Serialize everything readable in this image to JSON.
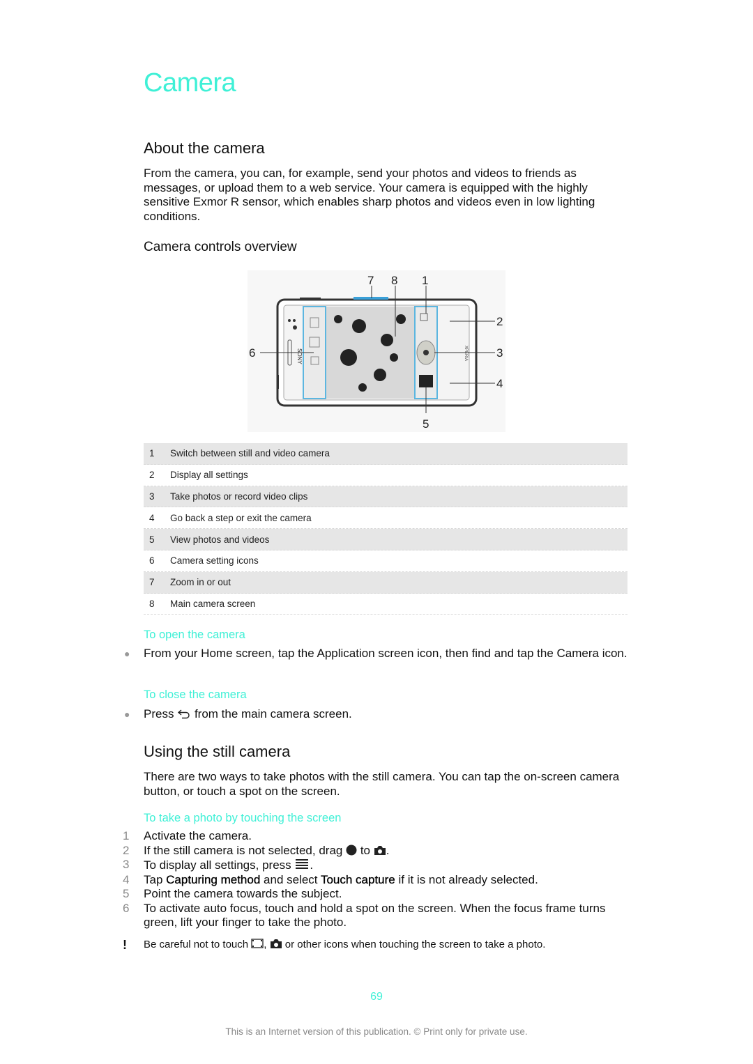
{
  "chapter_title": "Camera",
  "about": {
    "heading": "About the camera",
    "body": "From the camera, you can, for example, send your photos and videos to friends as messages, or upload them to a web service. Your camera is equipped with the highly sensitive Exmor R sensor, which enables sharp photos and videos even in low lighting conditions."
  },
  "controls": {
    "heading": "Camera controls overview",
    "figure": {
      "callouts": [
        "1",
        "2",
        "3",
        "4",
        "5",
        "6",
        "7",
        "8"
      ],
      "brand_left": "SONY",
      "brand_right": "XPERIA"
    },
    "legend": [
      {
        "num": "1",
        "label": "Switch between still and video camera"
      },
      {
        "num": "2",
        "label": "Display all settings"
      },
      {
        "num": "3",
        "label": "Take photos or record video clips"
      },
      {
        "num": "4",
        "label": "Go back a step or exit the camera"
      },
      {
        "num": "5",
        "label": "View photos and videos"
      },
      {
        "num": "6",
        "label": "Camera setting icons"
      },
      {
        "num": "7",
        "label": "Zoom in or out"
      },
      {
        "num": "8",
        "label": "Main camera screen"
      }
    ]
  },
  "open_camera": {
    "heading": "To open the camera",
    "bullet": "From your Home screen, tap the Application screen icon, then find and tap the Camera icon."
  },
  "close_camera": {
    "heading": "To close the camera",
    "bullet_pre": "Press",
    "bullet_post": "from the main camera screen.",
    "icon": "back-icon"
  },
  "still_camera": {
    "heading": "Using the still camera",
    "body": "There are two ways to take photos with the still camera. You can tap the on-screen camera button, or touch a spot on the screen.",
    "procedure_heading": "To take a photo by touching the screen",
    "steps": [
      {
        "num": "1",
        "text": "Activate the camera."
      },
      {
        "num": "2",
        "pre": "If the still camera is not selected, drag",
        "mid": "to",
        "post": "."
      },
      {
        "num": "3",
        "pre": "To display all settings, press",
        "post": "."
      },
      {
        "num": "4",
        "pre": "Tap",
        "bold1": "Capturing method",
        "mid": "and select",
        "bold2": "Touch capture",
        "post": "if it is not already selected."
      },
      {
        "num": "5",
        "text": "Point the camera towards the subject."
      },
      {
        "num": "6",
        "text": "To activate auto focus, touch and hold a spot on the screen. When the focus frame turns green, lift your finger to take the photo."
      }
    ],
    "note_mark": "!",
    "note_pre": "Be careful not to touch",
    "note_post": "or other icons when touching the screen to take a photo."
  },
  "page_number": "69",
  "footer": "This is an Internet version of this publication. © Print only for private use."
}
